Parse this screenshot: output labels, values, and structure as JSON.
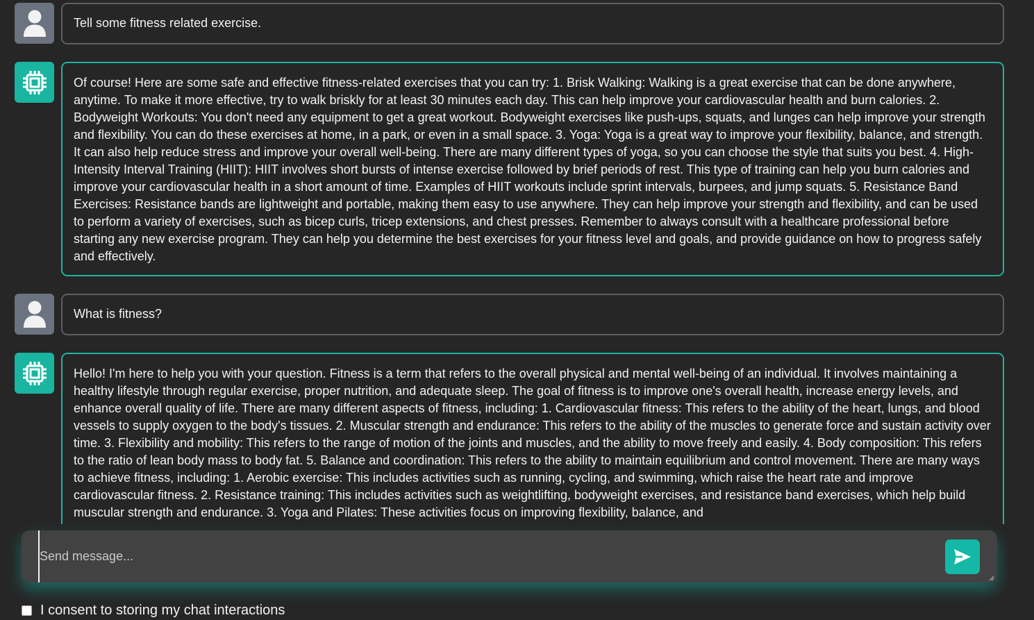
{
  "messages": [
    {
      "role": "user",
      "avatar_icon": "user-icon",
      "text": "Tell some fitness related exercise."
    },
    {
      "role": "assistant",
      "avatar_icon": "chip-icon",
      "text": "Of course! Here are some safe and effective fitness-related exercises that you can try: 1. Brisk Walking: Walking is a great exercise that can be done anywhere, anytime. To make it more effective, try to walk briskly for at least 30 minutes each day. This can help improve your cardiovascular health and burn calories. 2. Bodyweight Workouts: You don't need any equipment to get a great workout. Bodyweight exercises like push-ups, squats, and lunges can help improve your strength and flexibility. You can do these exercises at home, in a park, or even in a small space. 3. Yoga: Yoga is a great way to improve your flexibility, balance, and strength. It can also help reduce stress and improve your overall well-being. There are many different types of yoga, so you can choose the style that suits you best. 4. High-Intensity Interval Training (HIIT): HIIT involves short bursts of intense exercise followed by brief periods of rest. This type of training can help you burn calories and improve your cardiovascular health in a short amount of time. Examples of HIIT workouts include sprint intervals, burpees, and jump squats. 5. Resistance Band Exercises: Resistance bands are lightweight and portable, making them easy to use anywhere. They can help improve your strength and flexibility, and can be used to perform a variety of exercises, such as bicep curls, tricep extensions, and chest presses. Remember to always consult with a healthcare professional before starting any new exercise program. They can help you determine the best exercises for your fitness level and goals, and provide guidance on how to progress safely and effectively."
    },
    {
      "role": "user",
      "avatar_icon": "user-icon",
      "text": "What is fitness?"
    },
    {
      "role": "assistant",
      "avatar_icon": "chip-icon",
      "text": "Hello! I'm here to help you with your question. Fitness is a term that refers to the overall physical and mental well-being of an individual. It involves maintaining a healthy lifestyle through regular exercise, proper nutrition, and adequate sleep. The goal of fitness is to improve one's overall health, increase energy levels, and enhance overall quality of life. There are many different aspects of fitness, including: 1. Cardiovascular fitness: This refers to the ability of the heart, lungs, and blood vessels to supply oxygen to the body's tissues. 2. Muscular strength and endurance: This refers to the ability of the muscles to generate force and sustain activity over time. 3. Flexibility and mobility: This refers to the range of motion of the joints and muscles, and the ability to move freely and easily. 4. Body composition: This refers to the ratio of lean body mass to body fat. 5. Balance and coordination: This refers to the ability to maintain equilibrium and control movement. There are many ways to achieve fitness, including: 1. Aerobic exercise: This includes activities such as running, cycling, and swimming, which raise the heart rate and improve cardiovascular fitness. 2. Resistance training: This includes activities such as weightlifting, bodyweight exercises, and resistance band exercises, which help build muscular strength and endurance. 3. Yoga and Pilates: These activities focus on improving flexibility, balance, and"
    }
  ],
  "composer": {
    "placeholder": "Send message...",
    "value": "",
    "send_icon": "send-icon"
  },
  "consent": {
    "label": "I consent to storing my chat interactions",
    "checked": false
  },
  "colors": {
    "accent": "#14b8a6",
    "background": "#262626",
    "user_avatar": "#6b7280"
  }
}
